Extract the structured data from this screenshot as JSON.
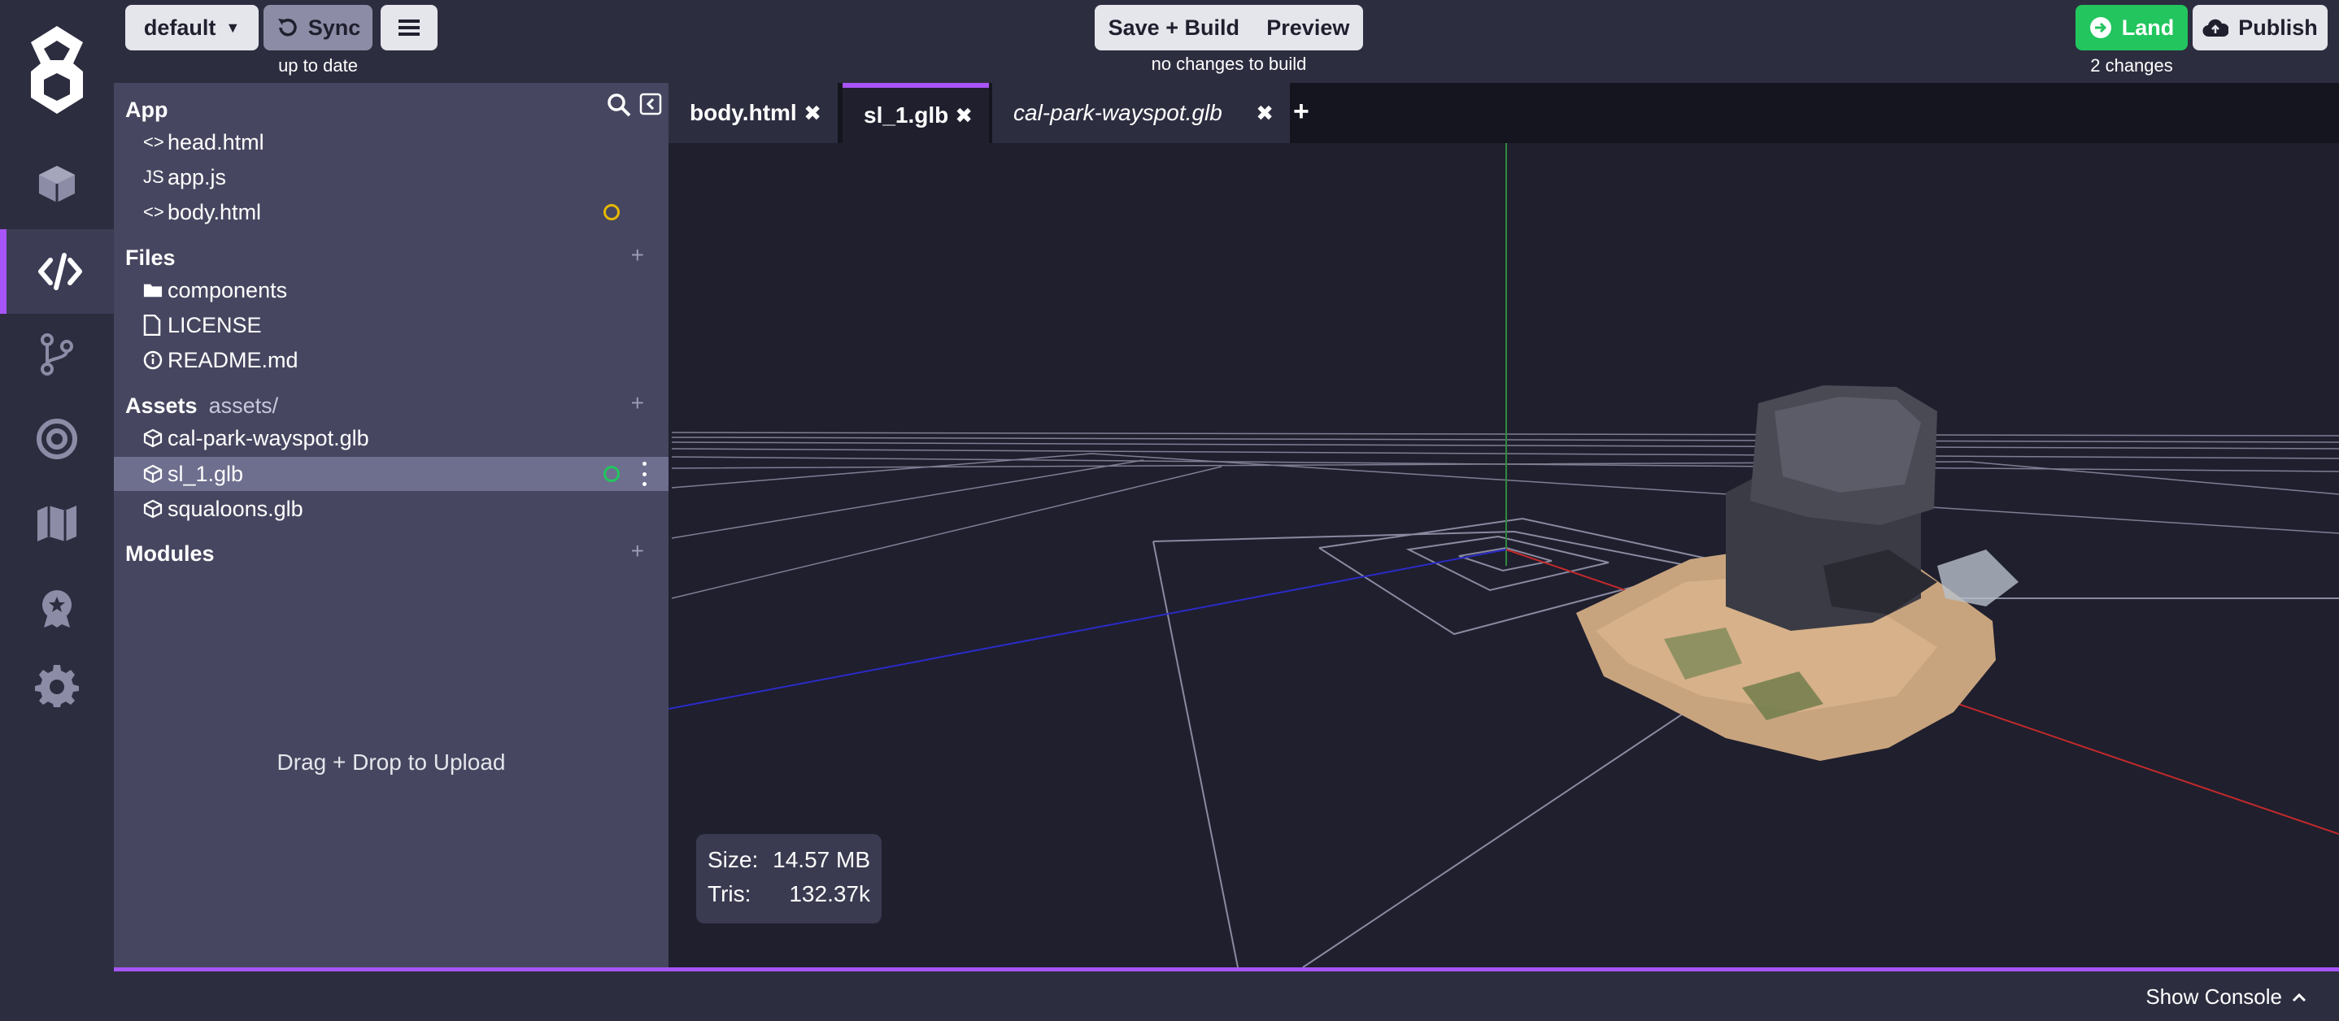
{
  "topbar": {
    "branch": "default",
    "sync_label": "Sync",
    "sync_status": "up to date",
    "save_build_label": "Save + Build",
    "preview_label": "Preview",
    "build_status": "no changes to build",
    "land_label": "Land",
    "publish_label": "Publish",
    "changes_status": "2 changes"
  },
  "rail": {
    "items": [
      "cube-icon",
      "code-icon",
      "branch-icon",
      "target-icon",
      "map-icon",
      "badge-icon",
      "gear-icon"
    ],
    "active": "code-icon",
    "accent": "#a855f7"
  },
  "sidebar": {
    "app": {
      "title": "App",
      "files": [
        {
          "icon": "<>",
          "name": "head.html"
        },
        {
          "icon": "JS",
          "name": "app.js"
        },
        {
          "icon": "<>",
          "name": "body.html",
          "status": "modified",
          "status_color": "#e6b800"
        }
      ]
    },
    "files": {
      "title": "Files",
      "items": [
        {
          "icon": "folder-icon",
          "name": "components"
        },
        {
          "icon": "file-icon",
          "name": "LICENSE"
        },
        {
          "icon": "info-icon",
          "name": "README.md"
        }
      ]
    },
    "assets": {
      "title": "Assets",
      "path": "assets/",
      "items": [
        {
          "icon": "cube-icon",
          "name": "cal-park-wayspot.glb"
        },
        {
          "icon": "cube-icon",
          "name": "sl_1.glb",
          "selected": true,
          "status": "synced",
          "status_color": "#22c55e"
        },
        {
          "icon": "cube-icon",
          "name": "squaloons.glb"
        }
      ]
    },
    "modules": {
      "title": "Modules"
    },
    "drop_hint": "Drag + Drop to Upload"
  },
  "tabs": [
    {
      "label": "body.html",
      "close": "✖",
      "active": false,
      "italic": false
    },
    {
      "label": "sl_1.glb",
      "close": "✖",
      "active": true,
      "italic": false
    },
    {
      "label": "cal-park-wayspot.glb",
      "close": "✖",
      "active": false,
      "italic": true
    }
  ],
  "tab_add": "+",
  "stats": {
    "size_label": "Size:",
    "size_value": "14.57 MB",
    "tris_label": "Tris:",
    "tris_value": "132.37k"
  },
  "console": {
    "label": "Show Console"
  }
}
